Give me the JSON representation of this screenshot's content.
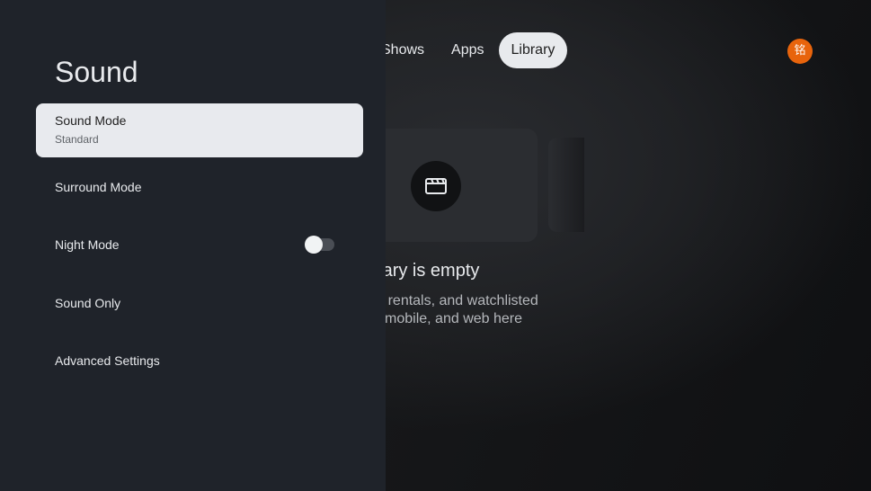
{
  "top_nav": {
    "tabs": [
      {
        "label": "Shows",
        "active": false
      },
      {
        "label": "Apps",
        "active": false
      },
      {
        "label": "Library",
        "active": true
      }
    ],
    "avatar_text": "铭",
    "avatar_color": "#e8640c"
  },
  "library": {
    "empty_title": "r Library is empty",
    "empty_desc_line1": "hases, rentals, and watchlisted",
    "empty_desc_line2": "ss TV, mobile, and web here",
    "card_icon": "movie-clapperboard-icon"
  },
  "panel": {
    "title": "Sound",
    "items": [
      {
        "label": "Sound Mode",
        "sub": "Standard",
        "focused": true
      },
      {
        "label": "Surround Mode"
      },
      {
        "label": "Night Mode",
        "toggle": false
      },
      {
        "label": "Sound Only"
      },
      {
        "label": "Advanced Settings"
      }
    ]
  },
  "colors": {
    "panel_bg": "#1f232a",
    "focus_bg": "#e8eaee",
    "accent_avatar": "#e8640c"
  }
}
